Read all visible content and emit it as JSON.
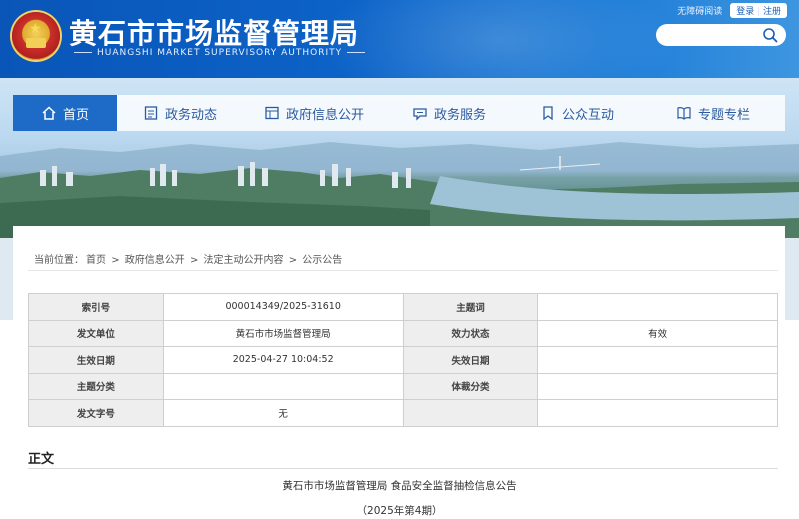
{
  "header": {
    "title_cn": "黄石市市场监督管理局",
    "title_en": "HUANGSHI MARKET SUPERVISORY AUTHORITY",
    "top_links": {
      "accessibility": "无障碍阅读",
      "login": "登录",
      "register": "注册"
    },
    "search": {
      "placeholder": "",
      "icon": "search-icon"
    }
  },
  "nav": {
    "items": [
      {
        "label": "首页",
        "icon": "home-icon",
        "active": true
      },
      {
        "label": "政务动态",
        "icon": "news-icon"
      },
      {
        "label": "政府信息公开",
        "icon": "info-icon"
      },
      {
        "label": "政务服务",
        "icon": "service-icon"
      },
      {
        "label": "公众互动",
        "icon": "interaction-icon"
      },
      {
        "label": "专题专栏",
        "icon": "book-icon"
      }
    ]
  },
  "breadcrumb": {
    "prefix": "当前位置：",
    "items": [
      "首页",
      "政府信息公开",
      "法定主动公开内容",
      "公示公告"
    ],
    "sep": ">"
  },
  "meta_table": {
    "rows": [
      {
        "k1": "索引号",
        "v1": "000014349/2025-31610",
        "k2": "主题词",
        "v2": ""
      },
      {
        "k1": "发文单位",
        "v1": "黄石市市场监督管理局",
        "k2": "效力状态",
        "v2": "有效"
      },
      {
        "k1": "生效日期",
        "v1": "2025-04-27 10:04:52",
        "k2": "失效日期",
        "v2": ""
      },
      {
        "k1": "主题分类",
        "v1": "",
        "k2": "体裁分类",
        "v2": ""
      },
      {
        "k1": "发文字号",
        "v1": "无",
        "k2": "",
        "v2": ""
      }
    ]
  },
  "article": {
    "section_label": "正文",
    "title": "黄石市市场监督管理局 食品安全监督抽检信息公告",
    "issue": "（2025年第4期）"
  },
  "colors": {
    "brand_blue": "#0c63c8",
    "nav_active": "#1d6bc6",
    "nav_text": "#2c5aa0"
  }
}
